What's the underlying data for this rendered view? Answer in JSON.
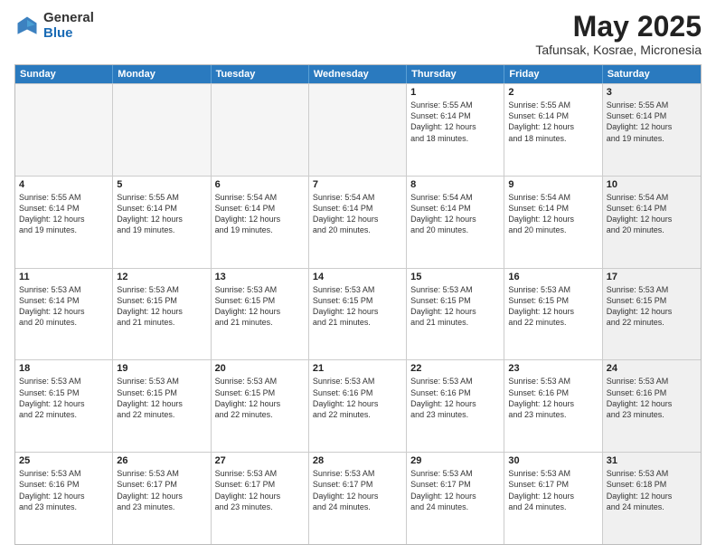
{
  "logo": {
    "general": "General",
    "blue": "Blue"
  },
  "title": {
    "month": "May 2025",
    "location": "Tafunsak, Kosrae, Micronesia"
  },
  "header": {
    "days": [
      "Sunday",
      "Monday",
      "Tuesday",
      "Wednesday",
      "Thursday",
      "Friday",
      "Saturday"
    ]
  },
  "rows": [
    [
      {
        "day": "",
        "info": "",
        "empty": true
      },
      {
        "day": "",
        "info": "",
        "empty": true
      },
      {
        "day": "",
        "info": "",
        "empty": true
      },
      {
        "day": "",
        "info": "",
        "empty": true
      },
      {
        "day": "1",
        "info": "Sunrise: 5:55 AM\nSunset: 6:14 PM\nDaylight: 12 hours\nand 18 minutes."
      },
      {
        "day": "2",
        "info": "Sunrise: 5:55 AM\nSunset: 6:14 PM\nDaylight: 12 hours\nand 18 minutes."
      },
      {
        "day": "3",
        "info": "Sunrise: 5:55 AM\nSunset: 6:14 PM\nDaylight: 12 hours\nand 19 minutes.",
        "shaded": true
      }
    ],
    [
      {
        "day": "4",
        "info": "Sunrise: 5:55 AM\nSunset: 6:14 PM\nDaylight: 12 hours\nand 19 minutes."
      },
      {
        "day": "5",
        "info": "Sunrise: 5:55 AM\nSunset: 6:14 PM\nDaylight: 12 hours\nand 19 minutes."
      },
      {
        "day": "6",
        "info": "Sunrise: 5:54 AM\nSunset: 6:14 PM\nDaylight: 12 hours\nand 19 minutes."
      },
      {
        "day": "7",
        "info": "Sunrise: 5:54 AM\nSunset: 6:14 PM\nDaylight: 12 hours\nand 20 minutes."
      },
      {
        "day": "8",
        "info": "Sunrise: 5:54 AM\nSunset: 6:14 PM\nDaylight: 12 hours\nand 20 minutes."
      },
      {
        "day": "9",
        "info": "Sunrise: 5:54 AM\nSunset: 6:14 PM\nDaylight: 12 hours\nand 20 minutes."
      },
      {
        "day": "10",
        "info": "Sunrise: 5:54 AM\nSunset: 6:14 PM\nDaylight: 12 hours\nand 20 minutes.",
        "shaded": true
      }
    ],
    [
      {
        "day": "11",
        "info": "Sunrise: 5:53 AM\nSunset: 6:14 PM\nDaylight: 12 hours\nand 20 minutes."
      },
      {
        "day": "12",
        "info": "Sunrise: 5:53 AM\nSunset: 6:15 PM\nDaylight: 12 hours\nand 21 minutes."
      },
      {
        "day": "13",
        "info": "Sunrise: 5:53 AM\nSunset: 6:15 PM\nDaylight: 12 hours\nand 21 minutes."
      },
      {
        "day": "14",
        "info": "Sunrise: 5:53 AM\nSunset: 6:15 PM\nDaylight: 12 hours\nand 21 minutes."
      },
      {
        "day": "15",
        "info": "Sunrise: 5:53 AM\nSunset: 6:15 PM\nDaylight: 12 hours\nand 21 minutes."
      },
      {
        "day": "16",
        "info": "Sunrise: 5:53 AM\nSunset: 6:15 PM\nDaylight: 12 hours\nand 22 minutes."
      },
      {
        "day": "17",
        "info": "Sunrise: 5:53 AM\nSunset: 6:15 PM\nDaylight: 12 hours\nand 22 minutes.",
        "shaded": true
      }
    ],
    [
      {
        "day": "18",
        "info": "Sunrise: 5:53 AM\nSunset: 6:15 PM\nDaylight: 12 hours\nand 22 minutes."
      },
      {
        "day": "19",
        "info": "Sunrise: 5:53 AM\nSunset: 6:15 PM\nDaylight: 12 hours\nand 22 minutes."
      },
      {
        "day": "20",
        "info": "Sunrise: 5:53 AM\nSunset: 6:15 PM\nDaylight: 12 hours\nand 22 minutes."
      },
      {
        "day": "21",
        "info": "Sunrise: 5:53 AM\nSunset: 6:16 PM\nDaylight: 12 hours\nand 22 minutes."
      },
      {
        "day": "22",
        "info": "Sunrise: 5:53 AM\nSunset: 6:16 PM\nDaylight: 12 hours\nand 23 minutes."
      },
      {
        "day": "23",
        "info": "Sunrise: 5:53 AM\nSunset: 6:16 PM\nDaylight: 12 hours\nand 23 minutes."
      },
      {
        "day": "24",
        "info": "Sunrise: 5:53 AM\nSunset: 6:16 PM\nDaylight: 12 hours\nand 23 minutes.",
        "shaded": true
      }
    ],
    [
      {
        "day": "25",
        "info": "Sunrise: 5:53 AM\nSunset: 6:16 PM\nDaylight: 12 hours\nand 23 minutes."
      },
      {
        "day": "26",
        "info": "Sunrise: 5:53 AM\nSunset: 6:17 PM\nDaylight: 12 hours\nand 23 minutes."
      },
      {
        "day": "27",
        "info": "Sunrise: 5:53 AM\nSunset: 6:17 PM\nDaylight: 12 hours\nand 23 minutes."
      },
      {
        "day": "28",
        "info": "Sunrise: 5:53 AM\nSunset: 6:17 PM\nDaylight: 12 hours\nand 24 minutes."
      },
      {
        "day": "29",
        "info": "Sunrise: 5:53 AM\nSunset: 6:17 PM\nDaylight: 12 hours\nand 24 minutes."
      },
      {
        "day": "30",
        "info": "Sunrise: 5:53 AM\nSunset: 6:17 PM\nDaylight: 12 hours\nand 24 minutes."
      },
      {
        "day": "31",
        "info": "Sunrise: 5:53 AM\nSunset: 6:18 PM\nDaylight: 12 hours\nand 24 minutes.",
        "shaded": true
      }
    ]
  ]
}
